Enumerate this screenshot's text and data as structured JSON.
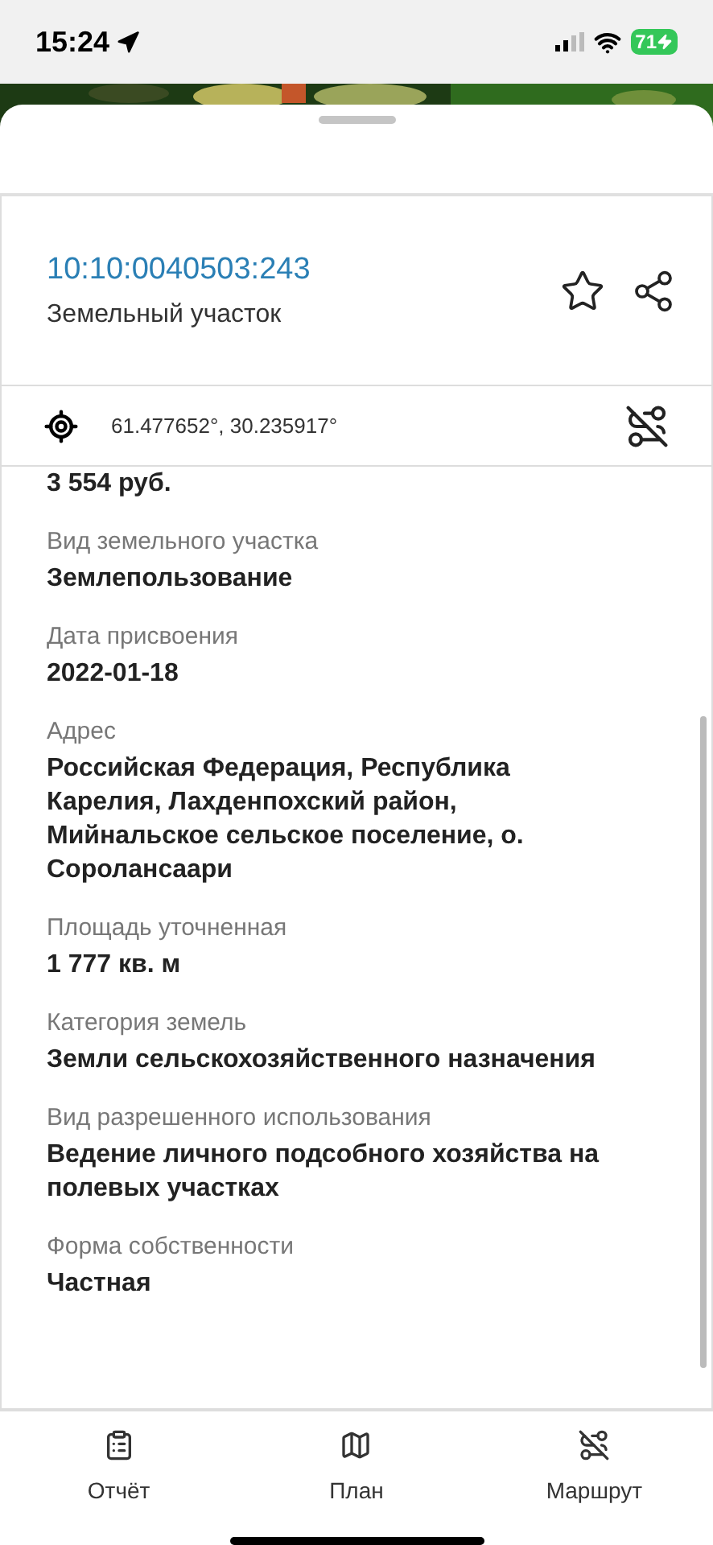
{
  "status_bar": {
    "time": "15:24",
    "battery": "71"
  },
  "header": {
    "cadastral_number": "10:10:0040503:243",
    "type": "Земельный участок"
  },
  "coordinates": "61.477652°, 30.235917°",
  "fields": [
    {
      "value": "3 554 руб."
    },
    {
      "label": "Вид земельного участка",
      "value": "Землепользование"
    },
    {
      "label": "Дата присвоения",
      "value": "2022-01-18"
    },
    {
      "label": "Адрес",
      "value": "Российская Федерация, Республика Карелия, Лахденпохский район, Мийнальское сельское поселение, о. Сороланcаари"
    },
    {
      "label": "Площадь уточненная",
      "value": "1 777 кв. м"
    },
    {
      "label": "Категория земель",
      "value": "Земли сельскохозяйственного назначения"
    },
    {
      "label": "Вид разрешенного использования",
      "value": "Ведение личного подсобного хозяйства на полевых участках"
    },
    {
      "label": "Форма собственности",
      "value": "Частная"
    }
  ],
  "tabs": [
    {
      "kind": "report",
      "label": "Отчёт"
    },
    {
      "kind": "plan",
      "label": "План"
    },
    {
      "kind": "route",
      "label": "Маршрут"
    }
  ]
}
